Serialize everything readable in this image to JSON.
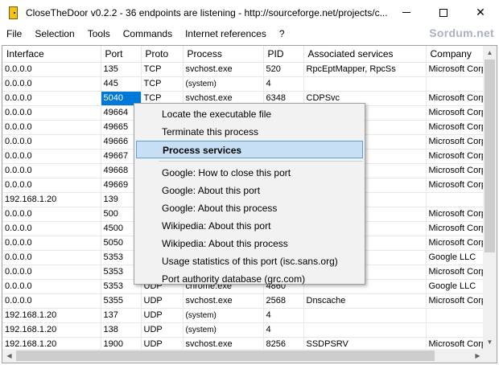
{
  "window": {
    "title": "CloseTheDoor v0.2.2 - 36 endpoints are listening - http://sourceforge.net/projects/c...",
    "icon": "door-icon"
  },
  "menu": [
    "File",
    "Selection",
    "Tools",
    "Commands",
    "Internet references",
    "?"
  ],
  "brand": "Sordum.net",
  "table": {
    "columns": [
      "Interface",
      "Port",
      "Proto",
      "Process",
      "PID",
      "Associated services",
      "Company"
    ],
    "rows": [
      [
        "0.0.0.0",
        "135",
        "TCP",
        "svchost.exe",
        "520",
        "RpcEptMapper, RpcSs",
        "Microsoft Corpor"
      ],
      [
        "0.0.0.0",
        "445",
        "TCP",
        "(system)",
        "4",
        "",
        ""
      ],
      [
        "0.0.0.0",
        "5040",
        "TCP",
        "svchost.exe",
        "6348",
        "CDPSvc",
        "Microsoft Corpor"
      ],
      [
        "0.0.0.0",
        "49664",
        "",
        "",
        "",
        "mSs, Vault...",
        "Microsoft Corpor"
      ],
      [
        "0.0.0.0",
        "49665",
        "",
        "",
        "",
        "",
        "Microsoft Corpor"
      ],
      [
        "0.0.0.0",
        "49666",
        "",
        "",
        "",
        "",
        "Microsoft Corpor"
      ],
      [
        "0.0.0.0",
        "49667",
        "",
        "",
        "",
        "",
        "Microsoft Corpor"
      ],
      [
        "0.0.0.0",
        "49668",
        "",
        "",
        "",
        "",
        "Microsoft Corpor"
      ],
      [
        "0.0.0.0",
        "49669",
        "",
        "",
        "",
        "",
        "Microsoft Corpor"
      ],
      [
        "192.168.1.20",
        "139",
        "",
        "",
        "",
        "",
        ""
      ],
      [
        "0.0.0.0",
        "500",
        "",
        "",
        "",
        "",
        "Microsoft Corpor"
      ],
      [
        "0.0.0.0",
        "4500",
        "",
        "",
        "",
        "",
        "Microsoft Corpor"
      ],
      [
        "0.0.0.0",
        "5050",
        "",
        "",
        "",
        "",
        "Microsoft Corpor"
      ],
      [
        "0.0.0.0",
        "5353",
        "",
        "",
        "",
        "",
        "Google LLC"
      ],
      [
        "0.0.0.0",
        "5353",
        "",
        "",
        "",
        "",
        "Microsoft Corpor"
      ],
      [
        "0.0.0.0",
        "5353",
        "UDP",
        "chrome.exe",
        "4860",
        "",
        "Google LLC"
      ],
      [
        "0.0.0.0",
        "5355",
        "UDP",
        "svchost.exe",
        "2568",
        "Dnscache",
        "Microsoft Corpor"
      ],
      [
        "192.168.1.20",
        "137",
        "UDP",
        "(system)",
        "4",
        "",
        ""
      ],
      [
        "192.168.1.20",
        "138",
        "UDP",
        "(system)",
        "4",
        "",
        ""
      ],
      [
        "192.168.1.20",
        "1900",
        "UDP",
        "svchost.exe",
        "8256",
        "SSDPSRV",
        "Microsoft Corpor"
      ]
    ],
    "selected_row": 2
  },
  "context_menu": {
    "groups": [
      [
        "Locate the executable file",
        "Terminate this process",
        "Process services"
      ],
      [
        "Google: How to close this port",
        "Google: About this port",
        "Google: About this process",
        "Wikipedia: About this port",
        "Wikipedia: About this process",
        "Usage statistics of this port (isc.sans.org)",
        "Port authority database (grc.com)"
      ]
    ],
    "highlighted": "Process services"
  },
  "colors": {
    "selection": "#0078d7",
    "menu_highlight": "#c6dff5",
    "brand": "#aab2c2"
  }
}
